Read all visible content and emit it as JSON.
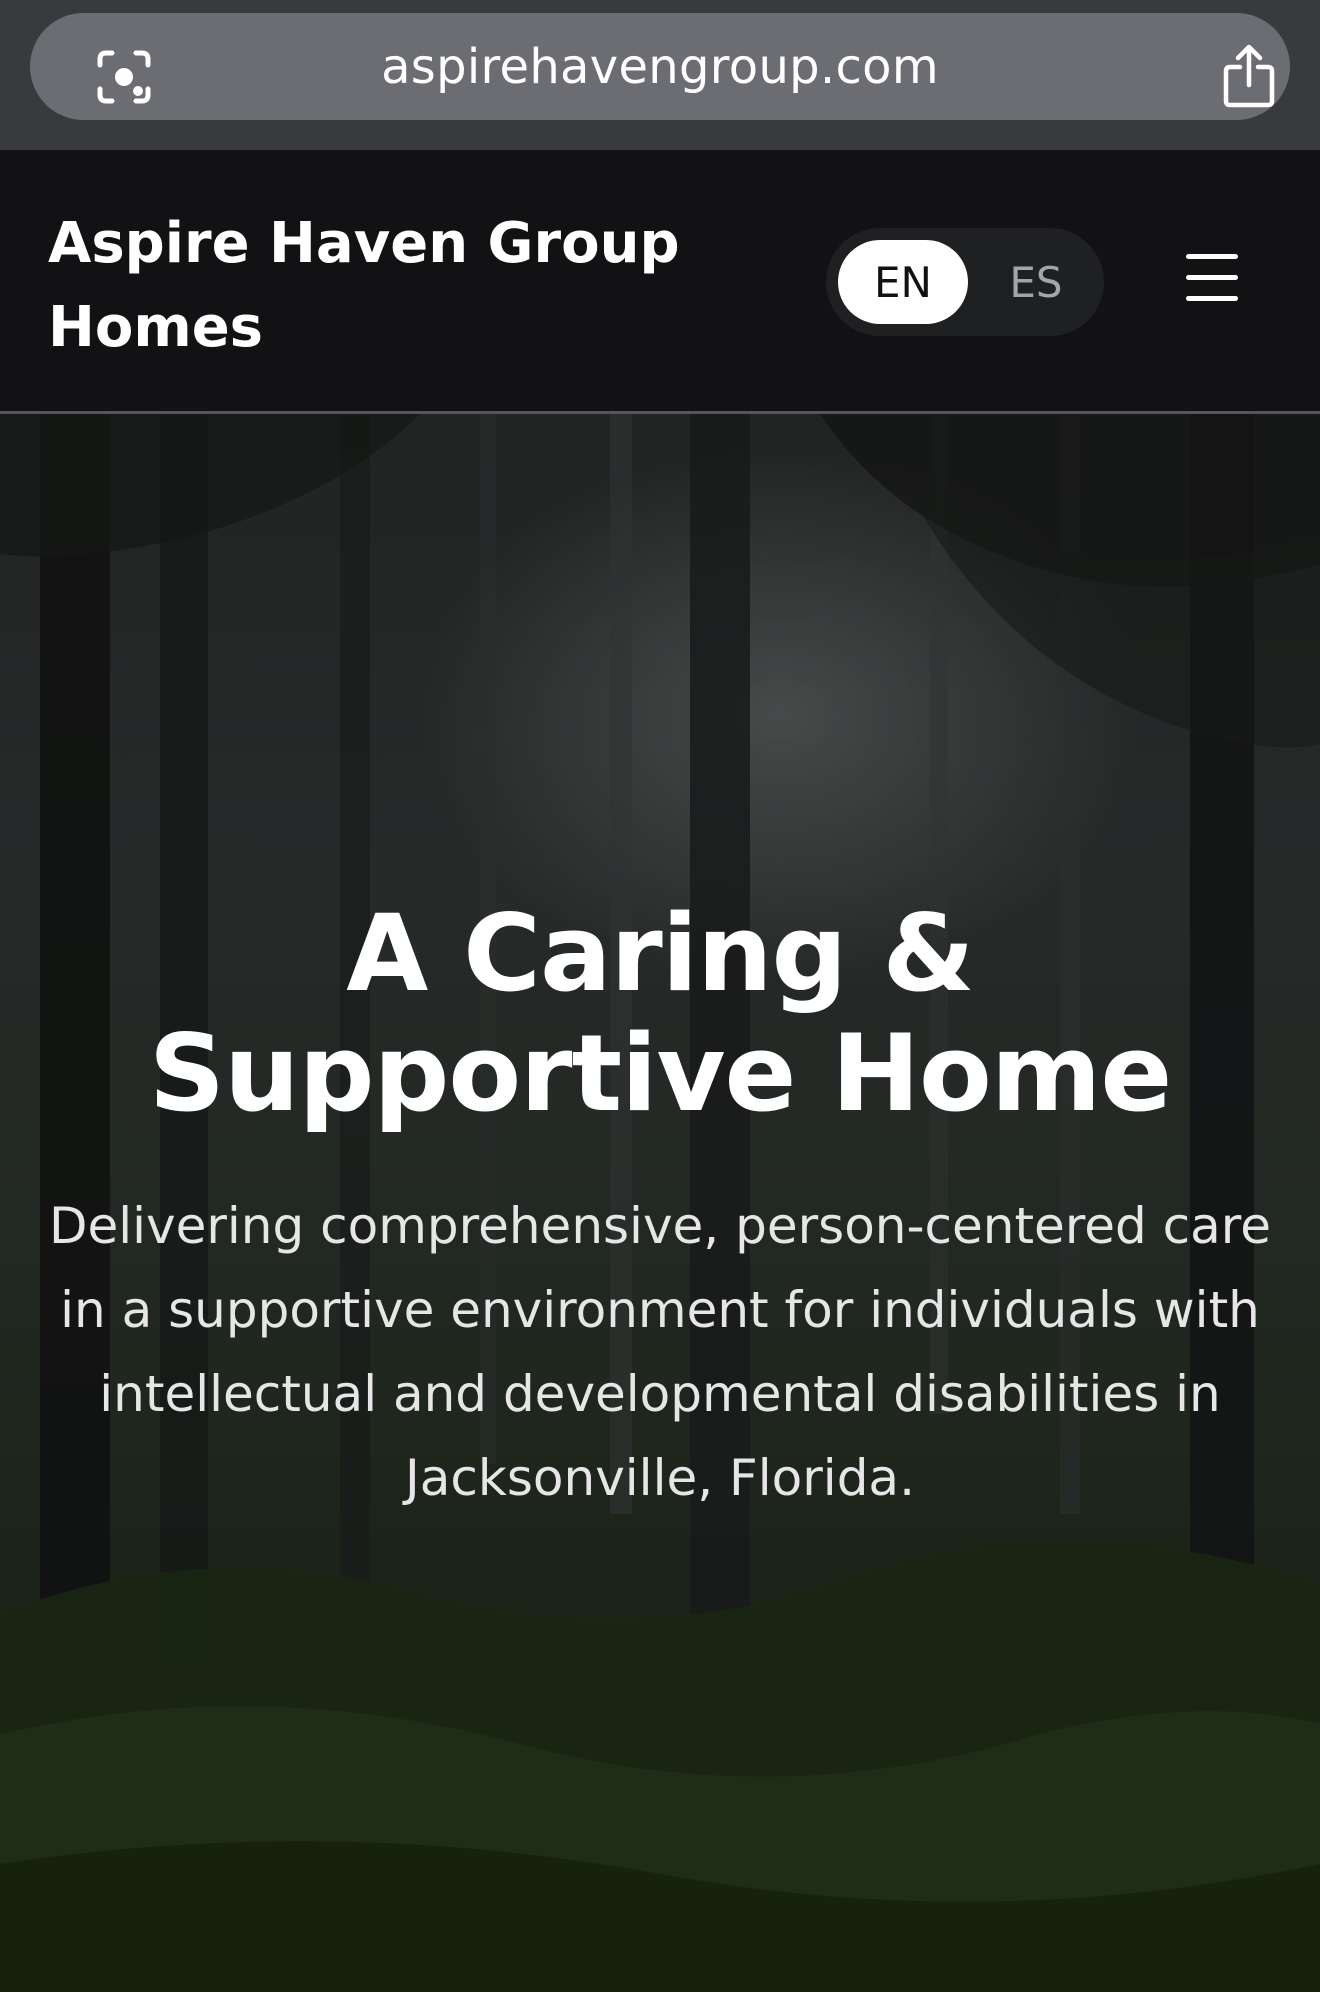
{
  "browser": {
    "url": "aspirehavengroup.com",
    "left_icon": "reader-view-icon",
    "right_icon": "share-icon"
  },
  "header": {
    "brand": "Aspire Haven Group Homes",
    "language_toggle": {
      "options": [
        "EN",
        "ES"
      ],
      "selected": "EN"
    },
    "menu_icon": "hamburger-menu-icon"
  },
  "hero": {
    "title": "A Caring & Supportive Home",
    "subtitle": "Delivering comprehensive, person-centered care in a supportive environment for individuals with intellectual and developmental disabilities in Jacksonville, Florida.",
    "background": "misty-forest-image"
  },
  "colors": {
    "browser_bar": "#393a3d",
    "url_pill": "#6b6d72",
    "header_bg": "#121214",
    "lang_selected_bg": "#ffffff",
    "lang_unselected_text": "#a3a5aa",
    "text_primary": "#ffffff"
  }
}
